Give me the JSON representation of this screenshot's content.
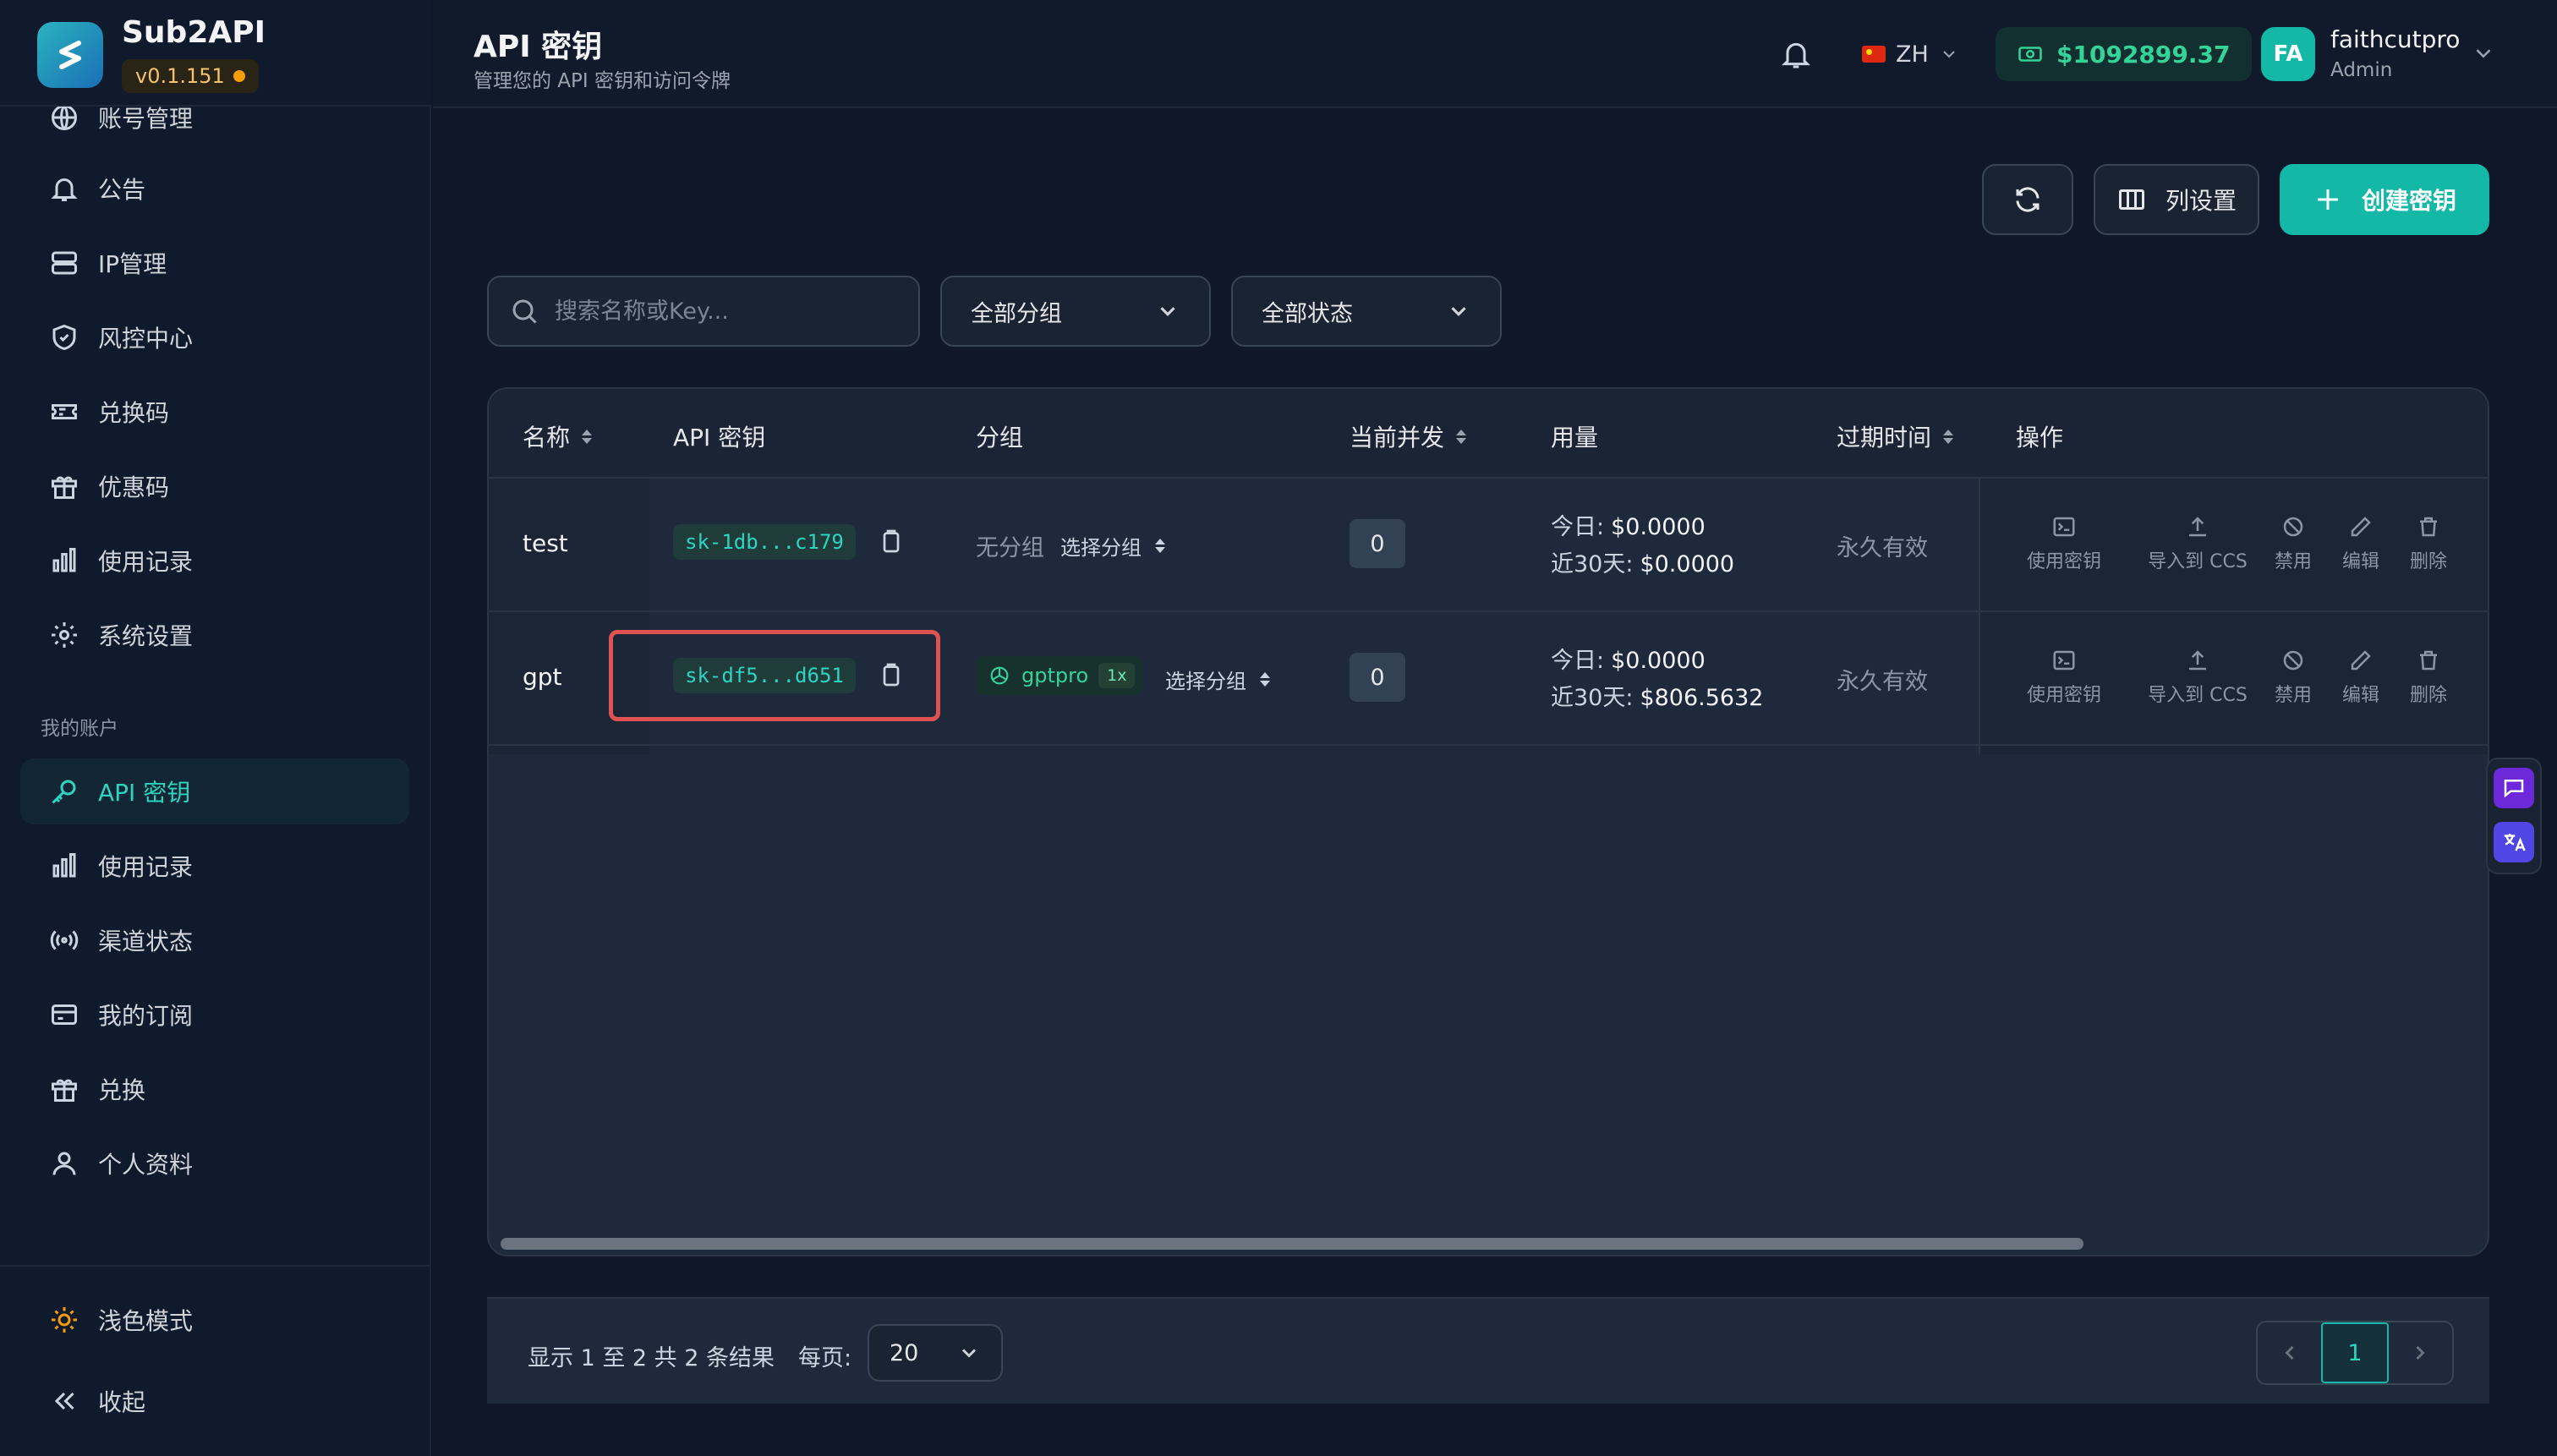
{
  "brand": {
    "name": "Sub2API",
    "version": "v0.1.151"
  },
  "sidebar": {
    "items": [
      {
        "label": "账号管理",
        "icon": "globe-icon"
      },
      {
        "label": "公告",
        "icon": "bell-icon"
      },
      {
        "label": "IP管理",
        "icon": "server-icon"
      },
      {
        "label": "风控中心",
        "icon": "shield-icon"
      },
      {
        "label": "兑换码",
        "icon": "ticket-icon"
      },
      {
        "label": "优惠码",
        "icon": "gift-icon"
      },
      {
        "label": "使用记录",
        "icon": "bar-chart-icon"
      },
      {
        "label": "系统设置",
        "icon": "gear-icon"
      }
    ],
    "section_label": "我的账户",
    "account_items": [
      {
        "label": "API 密钥",
        "icon": "key-icon",
        "active": true
      },
      {
        "label": "使用记录",
        "icon": "bar-chart-icon"
      },
      {
        "label": "渠道状态",
        "icon": "signal-icon"
      },
      {
        "label": "我的订阅",
        "icon": "credit-card-icon"
      },
      {
        "label": "兑换",
        "icon": "gift-icon"
      },
      {
        "label": "个人资料",
        "icon": "user-icon"
      }
    ],
    "theme_toggle": "浅色模式",
    "collapse": "收起"
  },
  "header": {
    "title": "API 密钥",
    "subtitle": "管理您的 API 密钥和访问令牌",
    "language": "ZH",
    "balance": "$1092899.37",
    "avatar_initials": "FA",
    "user_name": "faithcutpro",
    "user_role": "Admin"
  },
  "toolbar": {
    "columns_label": "列设置",
    "create_label": "创建密钥"
  },
  "filters": {
    "search_placeholder": "搜索名称或Key...",
    "group": "全部分组",
    "status": "全部状态"
  },
  "table": {
    "columns": {
      "name": "名称",
      "key": "API 密钥",
      "group": "分组",
      "concurrency": "当前并发",
      "usage": "用量",
      "expires": "过期时间",
      "actions": "操作"
    },
    "usage_labels": {
      "today": "今日:",
      "last30": "近30天:"
    },
    "select_group_label": "选择分组",
    "ops": [
      "使用密钥",
      "导入到 CCS",
      "禁用",
      "编辑",
      "删除"
    ],
    "rows": [
      {
        "name": "test",
        "key": "sk-1db...c179",
        "group": "无分组",
        "concurrency": "0",
        "today": "$0.0000",
        "last30": "$0.0000",
        "expires": "永久有效"
      },
      {
        "name": "gpt",
        "key": "sk-df5...d651",
        "group": "gptpro",
        "group_multiplier": "1x",
        "concurrency": "0",
        "today": "$0.0000",
        "last30": "$806.5632",
        "expires": "永久有效"
      }
    ]
  },
  "footer": {
    "result_text": "显示 1 至 2 共 2 条结果",
    "per_page_label": "每页:",
    "per_page": "20",
    "current_page": "1"
  },
  "colors": {
    "accent": "#14b8a6",
    "background": "#0f1728",
    "highlight": "#e05252"
  }
}
